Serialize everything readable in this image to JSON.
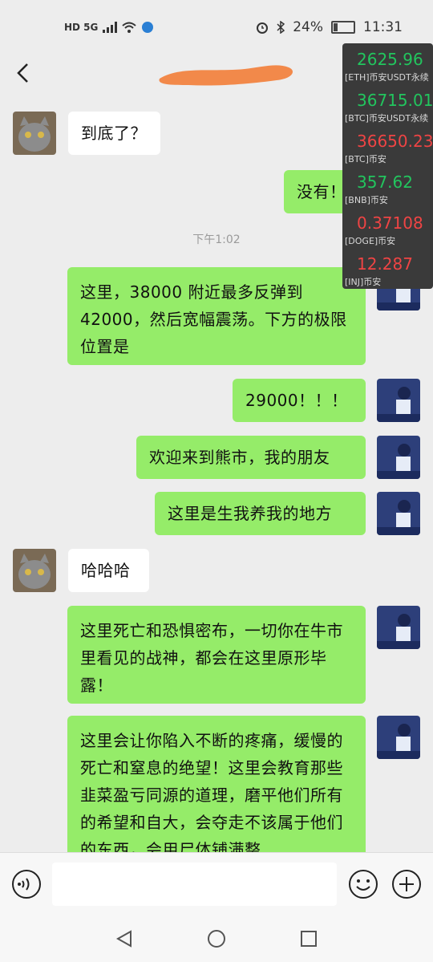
{
  "status": {
    "left_icons": "HD 5G",
    "battery": "24%",
    "time": "11:31",
    "battery_level": 0.24
  },
  "chat": {
    "time_divider": "下午1:02",
    "messages": [
      {
        "side": "left",
        "text": "到底了？"
      },
      {
        "side": "right",
        "text": "没有！"
      },
      {
        "side": "right",
        "text": "这里，38000 附近最多反弹到 42000，然后宽幅震荡。下方的极限位置是"
      },
      {
        "side": "right",
        "text": "29000！！！"
      },
      {
        "side": "right",
        "text": "欢迎来到熊市，我的朋友"
      },
      {
        "side": "right",
        "text": "这里是生我养我的地方"
      },
      {
        "side": "left",
        "text": "哈哈哈"
      },
      {
        "side": "right",
        "text": "这里死亡和恐惧密布，一切你在牛市里看见的战神，都会在这里原形毕露！"
      },
      {
        "side": "right",
        "text": "这里会让你陷入不断的疼痛，缓慢的死亡和窒息的绝望！这里会教育那些韭菜盈亏同源的道理，磨平他们所有的希望和自大，会夺走不该属于他们的东西，会用尸体铺满整"
      }
    ]
  },
  "ticker": [
    {
      "value": "2625.96",
      "label": "[ETH]币安USDT永续",
      "color": "#22c55e"
    },
    {
      "value": "36715.01",
      "label": "[BTC]币安USDT永续",
      "color": "#22c55e"
    },
    {
      "value": "36650.23",
      "label": "[BTC]币安",
      "color": "#ef4444"
    },
    {
      "value": "357.62",
      "label": "[BNB]币安",
      "color": "#22c55e"
    },
    {
      "value": "0.37108",
      "label": "[DOGE]币安",
      "color": "#ef4444"
    },
    {
      "value": "12.287",
      "label": "[INJ]币安",
      "color": "#ef4444"
    }
  ]
}
